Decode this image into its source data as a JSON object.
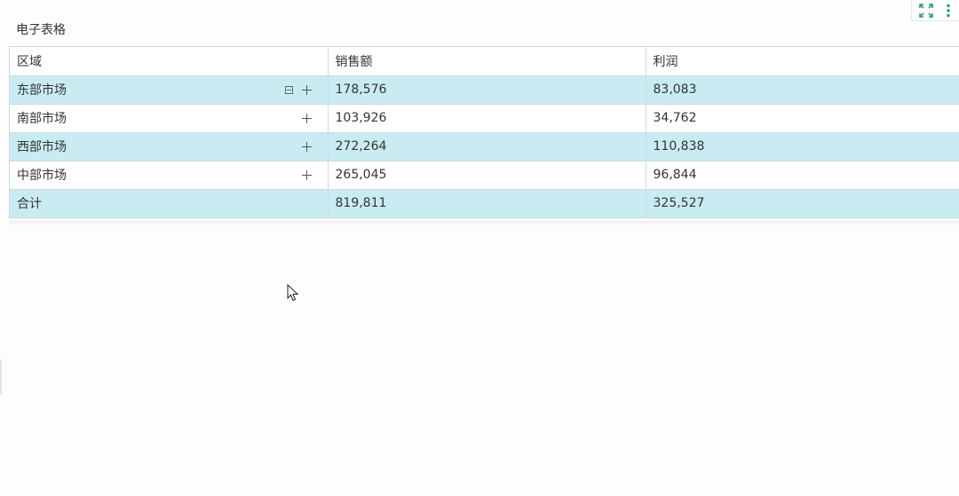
{
  "widget": {
    "title": "电子表格"
  },
  "toolbar": {
    "icons": [
      "fullscreen-icon",
      "more-vertical-icon"
    ],
    "accent_color": "#2e9b5f"
  },
  "table": {
    "headers": [
      "区域",
      "销售额",
      "利润"
    ],
    "rows": [
      {
        "region": "东部市场",
        "sales": "178,576",
        "profit": "83,083"
      },
      {
        "region": "南部市场",
        "sales": "103,926",
        "profit": "34,762"
      },
      {
        "region": "西部市场",
        "sales": "272,264",
        "profit": "110,838"
      },
      {
        "region": "中部市场",
        "sales": "265,045",
        "profit": "96,844"
      }
    ],
    "total": {
      "label": "合计",
      "sales": "819,811",
      "profit": "325,527"
    },
    "row_highlight_color": "#c9ecf2"
  }
}
